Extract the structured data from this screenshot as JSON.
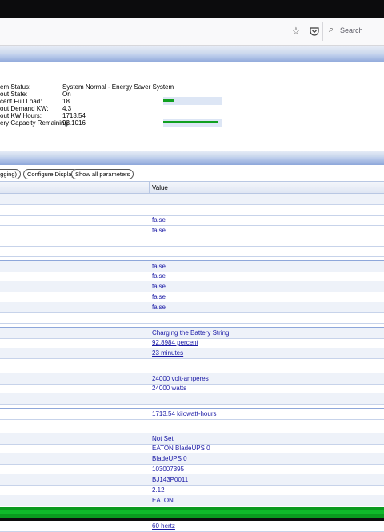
{
  "browser": {
    "search_placeholder": "Search",
    "bookmark_icon": "star-icon",
    "pocket_icon": "pocket-icon"
  },
  "status": {
    "labels": [
      "em Status:",
      "out State:",
      "cent Full Load:",
      "out Demand KW:",
      "out KW Hours:",
      "ery Capacity Remaining:"
    ],
    "values": [
      "System Normal - Energy Saver System",
      "On",
      "18",
      "4.3",
      "1713.54",
      "93.1016"
    ],
    "full_load_percent": 18,
    "battery_percent": 93.1016
  },
  "buttons": {
    "logging": "ogging)",
    "configure": "Configure Display",
    "show_all": "Show all parameters"
  },
  "table": {
    "value_header": "Value",
    "rows": [
      "",
      "",
      "false",
      "false",
      "",
      "",
      "false",
      "false",
      "false",
      "false",
      "false",
      "",
      "Charging the Battery String",
      "92.8984 percent",
      "23 minutes",
      "",
      "24000 volt-amperes",
      "24000 watts",
      "",
      "1713.54 kilowatt-hours",
      "",
      "Not Set",
      "EATON BladeUPS 0",
      "BladeUPS 0",
      "103007395",
      "BJ143P0011",
      "2.12",
      "EATON",
      "",
      "60 hertz"
    ]
  },
  "colors": {
    "meter_fill": "#10a020",
    "band": "#8ea7da",
    "link": "#1a1aa6",
    "footer": "#0a9a1f"
  }
}
